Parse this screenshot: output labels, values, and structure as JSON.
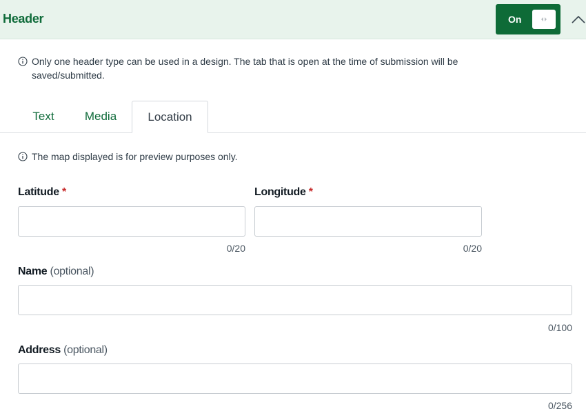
{
  "header": {
    "title": "Header",
    "toggle_label": "On",
    "toggle_state": "on",
    "accent_color": "#0e6b37"
  },
  "notice": {
    "icon": "info-icon",
    "line1": "Only one header type can be used in a design. The tab that is open at the time of submission will be",
    "line2": "saved/submitted."
  },
  "tabs": [
    {
      "label": "Text",
      "active": false
    },
    {
      "label": "Media",
      "active": false
    },
    {
      "label": "Location",
      "active": true
    }
  ],
  "map_notice": {
    "icon": "info-icon",
    "text": "The map displayed is for preview purposes only."
  },
  "form": {
    "latitude": {
      "label": "Latitude",
      "required_mark": "*",
      "value": "",
      "counter": "0/20"
    },
    "longitude": {
      "label": "Longitude",
      "required_mark": "*",
      "value": "",
      "counter": "0/20"
    },
    "name": {
      "label": "Name",
      "optional_text": "(optional)",
      "value": "",
      "counter": "0/100"
    },
    "address": {
      "label": "Address",
      "optional_text": "(optional)",
      "value": "",
      "counter": "0/256"
    }
  }
}
